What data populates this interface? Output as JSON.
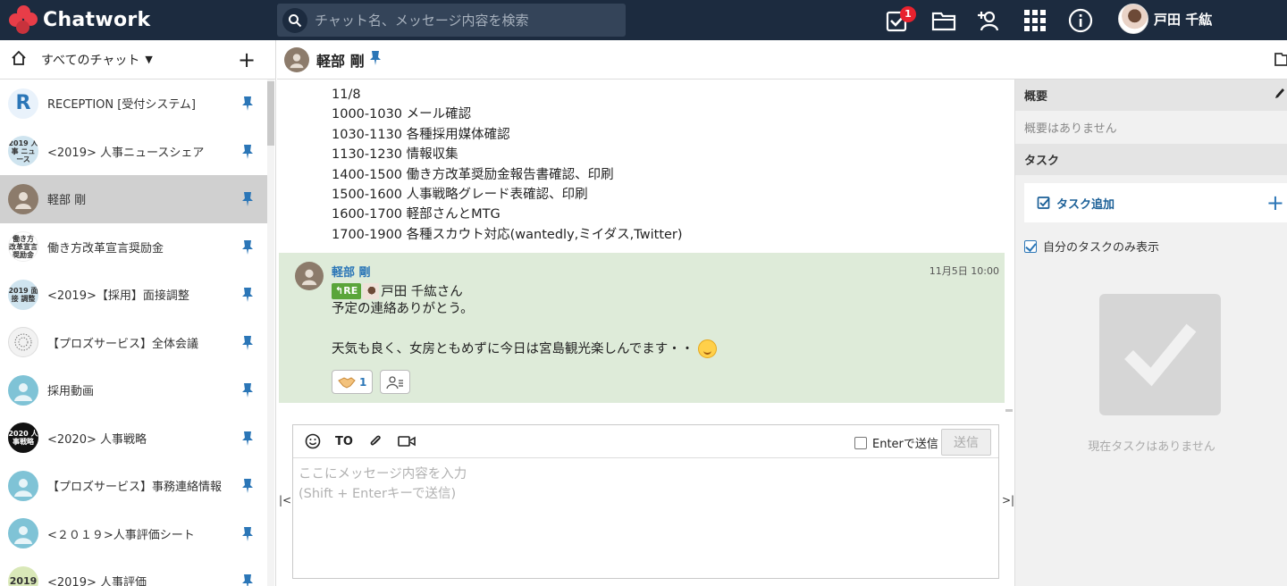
{
  "app": {
    "brand": "Chatwork",
    "search_placeholder": "チャット名、メッセージ内容を検索",
    "task_badge": "1",
    "user_name": "戸田 千紘"
  },
  "sidebar": {
    "filter_label": "すべてのチャット",
    "rooms": [
      {
        "name": "RECEPTION [受付システム]",
        "avatar_text": "R",
        "avatar_bg": "#e9f2fb",
        "avatar_color": "#2b76b7"
      },
      {
        "name": "<2019> 人事ニュースシェア",
        "avatar_text": "2019 人事 ニュース",
        "avatar_bg": "#cfe4ef",
        "avatar_color": "#222"
      },
      {
        "name": "軽部 剛",
        "avatar_text": "",
        "avatar_bg": "#8c7b6b",
        "avatar_color": "#fff",
        "active": true
      },
      {
        "name": "働き方改革宣言奨励金",
        "avatar_text": "働き方 改革宣言 奨励金",
        "avatar_bg": "#ffffff",
        "avatar_color": "#222"
      },
      {
        "name": "<2019>【採用】面接調整",
        "avatar_text": "2019 面接 調整",
        "avatar_bg": "#cfe4ef",
        "avatar_color": "#222"
      },
      {
        "name": "【プロズサービス】全体会議",
        "avatar_text": "",
        "avatar_bg": "#eeeeee",
        "avatar_color": "#222"
      },
      {
        "name": "採用動画",
        "avatar_text": "",
        "avatar_bg": "#7fc3d6",
        "avatar_color": "#fff"
      },
      {
        "name": "<2020> 人事戦略",
        "avatar_text": "2020 人事戦略",
        "avatar_bg": "#111111",
        "avatar_color": "#fff"
      },
      {
        "name": "【プロズサービス】事務連絡情報",
        "avatar_text": "",
        "avatar_bg": "#7fc3d6",
        "avatar_color": "#fff"
      },
      {
        "name": "<２０１９>人事評価シート",
        "avatar_text": "",
        "avatar_bg": "#7fc3d6",
        "avatar_color": "#fff"
      },
      {
        "name": "<2019> 人事評価",
        "avatar_text": "2019",
        "avatar_bg": "#d9e8b8",
        "avatar_color": "#222"
      }
    ]
  },
  "chat": {
    "title": "軽部 剛",
    "schedule_lines": [
      "11/8",
      "1000-1030 メール確認",
      "1030-1130 各種採用媒体確認",
      "1130-1230 情報収集",
      "1400-1500 働き方改革奨励金報告書確認、印刷",
      "1500-1600 人事戦略グレード表確認、印刷",
      "1600-1700 軽部さんとMTG",
      "1700-1900 各種スカウト対応(wantedly,ミイダス,Twitter)"
    ],
    "message": {
      "sender": "軽部 剛",
      "time": "11月5日 10:00",
      "re_label": "RE",
      "re_to": "戸田 千紘さん",
      "line1": "予定の連絡ありがとう。",
      "line2": "天気も良く、女房ともめずに今日は宮島観光楽しんでます・・",
      "reaction_count": "1"
    }
  },
  "composer": {
    "to_label": "TO",
    "enter_send_label": "Enterで送信",
    "send_label": "送信",
    "placeholder": "ここにメッセージ内容を入力\n(Shift + Enterキーで送信)"
  },
  "right_panel": {
    "overview_title": "概要",
    "overview_empty": "概要はありません",
    "task_title": "タスク",
    "task_add_label": "タスク追加",
    "own_tasks_label": "自分のタスクのみ表示",
    "no_tasks_label": "現在タスクはありません"
  },
  "colors": {
    "header_bg": "#1c2b3f",
    "brand_red": "#e83d48",
    "link_blue": "#2b76b7",
    "message_highlight": "#deebd9"
  }
}
